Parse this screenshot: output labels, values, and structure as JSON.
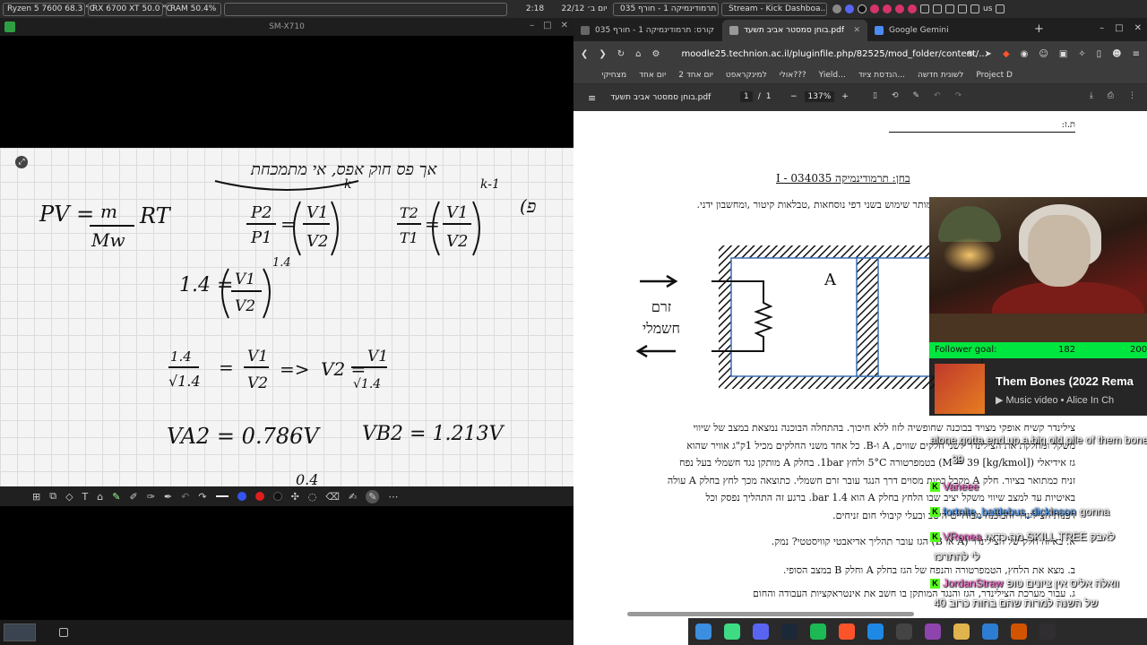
{
  "sysbar": {
    "cpu": "Ryzen 5 7600  68.3 °C",
    "gpu": "RX 6700 XT 50.0 °C",
    "ram": "RAM   50.4%",
    "clock": "2:18",
    "date": "יום ב׳ 22/12",
    "tasks": [
      "קורס: תרמודינמיקה 1 - חורף 035...",
      "Stream - Kick Dashboa..."
    ],
    "lang": "us"
  },
  "left_window": {
    "title": "SM-X710",
    "notes": {
      "top_text": "אך פס חוק אפס, אי מתמכחת",
      "eq_ideal_lhs": "PV =",
      "eq_ideal_frac_num": "m",
      "eq_ideal_frac_den": "Mw",
      "eq_ideal_rhs": "RT",
      "eq_p_num": "P2",
      "eq_p_den": "P1",
      "eq_v_num": "V1",
      "eq_v_den": "V2",
      "exp_k": "k",
      "eq_t_num": "T2",
      "eq_t_den": "T1",
      "exp_k1": "k-1",
      "paren": "(פ",
      "eq2_lhs": "1.4 =",
      "exp_14": "1.4",
      "eq3_lhs_num": "1.4",
      "eq3_lhs_den": "√1.4",
      "eq3_arrow": "=>",
      "eq3_v2": "V2 =",
      "eq3_rhs_den": "√1.4",
      "result1": "VA2 = 0.786V",
      "result2": "VB2 = 1.213V",
      "partial": "0.4"
    }
  },
  "browser": {
    "tabs": [
      {
        "label": "קורס: תרמודינמיקה 1 - חורף 035",
        "active": false
      },
      {
        "label": "בוחן סמסטר אביב תשעד.pdf",
        "active": true
      },
      {
        "label": "Google Gemini",
        "active": false
      }
    ],
    "url": "moodle25.technion.ac.il/pluginfile.php/82525/mod_folder/content/...",
    "bookmarks": [
      "Project D",
      "לשונית חדשה",
      "הנדסת ציוד...",
      "Yield...",
      "אולי???",
      "למינקראפט",
      "יום אחד 2",
      "יום אחד",
      "מצחיקי"
    ],
    "pdf_toolbar": {
      "filename": "בוחן סמסטר אביב תשעד.pdf",
      "page": "1",
      "sep": "/",
      "pages": "1",
      "zoom": "137%"
    }
  },
  "pdf": {
    "id_line": "ת.ז:",
    "title": "בחן: תרמודינמיקה I - 034035",
    "instructions": "מותר שימוש בשני דפי נוסחאות ,טבלאות קיטור ,ומחשבון ידני.",
    "diagram_label_A": "A",
    "diagram_current_1": "זרם",
    "diagram_current_2": "חשמלי",
    "paragraph_lines": [
      "צילינדר קשיח אופקי מצויד בבוכנה שחופשיה לזוז ללא חיכוך. בהתחלה הבוכנה נמצאת במצב של שיווי",
      "משקל ומחלקת את הצילינדר לשני חלקים שווים, A ו-B. כל אחד משני החלקים מכיל 1ק\"ג אוויר שהוא",
      "גז אידיאלי (M = 39 [kg/kmol]) בטמפרטורה 5°C ולחץ 1bar. בחלק A מותקן נגד חשמלי בעל נפח",
      "זניח כמתואר בציור. חלק A מקבל כמות מסוים דרך הנגד עובר זרם חשמלי. כתוצאה מכך לחץ בחלק A עולה",
      "באיטיות עד למצב שיווי משקל יציב שבו הלחץ בחלק A הוא 1.4 bar. ברגע זה התהליך נפסק וכל",
      "דפנות הצילינדר והבוכנה מבודדים היטב ובעלי קיבולי חום זניחים."
    ],
    "q_a": "א. באיזה חלק של הצילינדר (A או B) הגז עובר תהליך אדיאבטי קוויסטטי? נמק.",
    "q_b": "ב. מצא את הלחץ, הטמפרטורה והנפח של הגז בחלק A וחלק B במצב הסופי.",
    "q_c": "ג. עבור מערכת הצילינדר, הגז והנגד המותקן בו חשב את אינטראקציות העבודה והחום"
  },
  "stream": {
    "goal_label": "Follower goal:",
    "goal_current": "182",
    "goal_target": "200",
    "music_title": "Them Bones (2022 Rema",
    "music_sub": "Music video • Alice In Ch",
    "chat": [
      {
        "user": "",
        "text": "alone gotta end up a big old pile of them bones"
      },
      {
        "user": "",
        "text": "39"
      },
      {
        "user": "Vaneee",
        "text": ""
      },
      {
        "user": "fortnite_battlebus_dickinson",
        "text": "gonna"
      },
      {
        "user": "VRonea",
        "text": "מה כדאי SKILL TREE לאבק"
      },
      {
        "user": "",
        "text": "לי להתרכז"
      },
      {
        "user": "JordanStraw",
        "text": "וואלה אליס אין ציונים טופ"
      },
      {
        "user": "",
        "text": "40 של השנה למרות שהם בחות כרוב"
      }
    ]
  }
}
